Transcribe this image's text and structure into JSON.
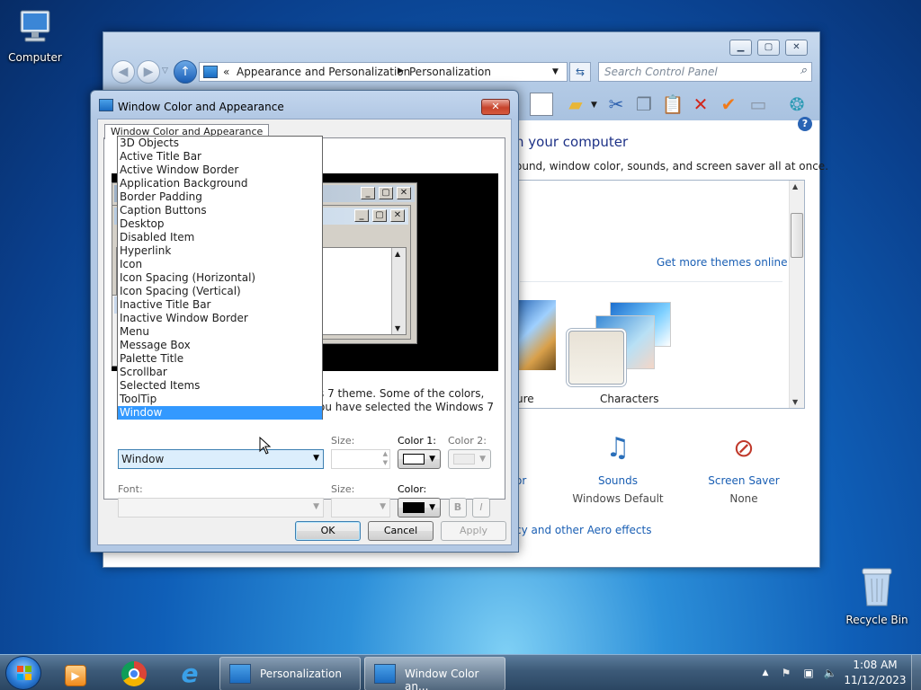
{
  "desktop": {
    "computer_label": "Computer",
    "recycle_label": "Recycle Bin"
  },
  "control_panel": {
    "breadcrumb": {
      "sep": "«",
      "parent": "Appearance and Personalization",
      "current": "Personalization"
    },
    "search_placeholder": "Search Control Panel",
    "heading_partial": "n your computer",
    "subtitle_partial": "ound, window color, sounds, and screen saver all at once.",
    "get_more_themes": "Get more themes online",
    "theme_partial_label": "ure",
    "theme_characters": "Characters",
    "sounds_label": "Sounds",
    "sounds_value": "Windows Default",
    "screensaver_label": "Screen Saver",
    "screensaver_value": "None",
    "partial_or": "or",
    "aero_link_partial": "cy and other Aero effects"
  },
  "dialog": {
    "title": "Window Color and Appearance",
    "tab": "Window Color and Appearance",
    "close": "✕",
    "desc_line1_partial": "s 7 theme.  Some of the colors,",
    "desc_line2_partial": "ou have selected the Windows 7",
    "item_selected": "Window",
    "size_label": "Size:",
    "color1_label": "Color 1:",
    "color2_label": "Color 2:",
    "font_label": "Font:",
    "size2_label": "Size:",
    "color_label": "Color:",
    "bold_label": "B",
    "italic_label": "I",
    "ok": "OK",
    "cancel": "Cancel",
    "apply": "Apply",
    "items": [
      "3D Objects",
      "Active Title Bar",
      "Active Window Border",
      "Application Background",
      "Border Padding",
      "Caption Buttons",
      "Desktop",
      "Disabled Item",
      "Hyperlink",
      "Icon",
      "Icon Spacing (Horizontal)",
      "Icon Spacing (Vertical)",
      "Inactive Title Bar",
      "Inactive Window Border",
      "Menu",
      "Message Box",
      "Palette Title",
      "Scrollbar",
      "Selected Items",
      "ToolTip",
      "Window"
    ],
    "selected_index": 20
  },
  "taskbar": {
    "personalization": "Personalization",
    "window_color": "Window Color an...",
    "time": "1:08 AM",
    "date": "11/12/2023"
  },
  "colors": {
    "accent": "#3399ff",
    "link": "#1a5fb4"
  }
}
